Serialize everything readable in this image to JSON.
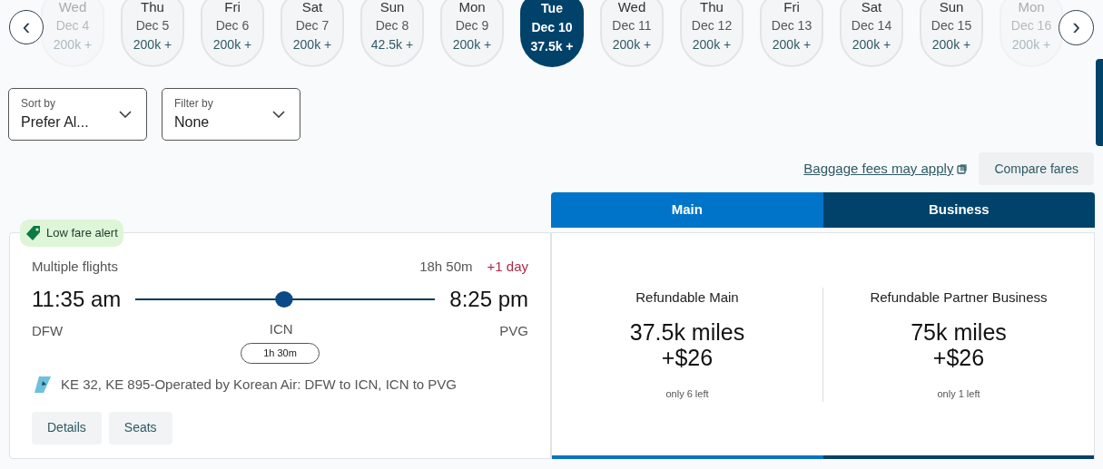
{
  "date_strip": {
    "prev_label": "‹",
    "next_label": "›",
    "dates": [
      {
        "weekday": "Wed",
        "date": "Dec 4",
        "price": "200k +",
        "selected": false,
        "faded": true
      },
      {
        "weekday": "Thu",
        "date": "Dec 5",
        "price": "200k +",
        "selected": false,
        "faded": false
      },
      {
        "weekday": "Fri",
        "date": "Dec 6",
        "price": "200k +",
        "selected": false,
        "faded": false
      },
      {
        "weekday": "Sat",
        "date": "Dec 7",
        "price": "200k +",
        "selected": false,
        "faded": false
      },
      {
        "weekday": "Sun",
        "date": "Dec 8",
        "price": "42.5k +",
        "selected": false,
        "faded": false
      },
      {
        "weekday": "Mon",
        "date": "Dec 9",
        "price": "200k +",
        "selected": false,
        "faded": false
      },
      {
        "weekday": "Tue",
        "date": "Dec 10",
        "price": "37.5k +",
        "selected": true,
        "faded": false
      },
      {
        "weekday": "Wed",
        "date": "Dec 11",
        "price": "200k +",
        "selected": false,
        "faded": false
      },
      {
        "weekday": "Thu",
        "date": "Dec 12",
        "price": "200k +",
        "selected": false,
        "faded": false
      },
      {
        "weekday": "Fri",
        "date": "Dec 13",
        "price": "200k +",
        "selected": false,
        "faded": false
      },
      {
        "weekday": "Sat",
        "date": "Dec 14",
        "price": "200k +",
        "selected": false,
        "faded": false
      },
      {
        "weekday": "Sun",
        "date": "Dec 15",
        "price": "200k +",
        "selected": false,
        "faded": false
      },
      {
        "weekday": "Mon",
        "date": "Dec 16",
        "price": "200k +",
        "selected": false,
        "faded": true
      }
    ]
  },
  "dropdowns": [
    {
      "label": "Sort by",
      "value": "Prefer Al..."
    },
    {
      "label": "Filter by",
      "value": "None"
    }
  ],
  "baggage_link": "Baggage fees may apply",
  "compare_button": "Compare fares",
  "cabin_tabs": [
    {
      "label": "Main",
      "color": "#0074c8"
    },
    {
      "label": "Business",
      "color": "#01426a"
    }
  ],
  "flight": {
    "badge": "Low fare alert",
    "type": "Multiple flights",
    "duration": "18h 50m",
    "day_offset": "+1 day",
    "depart_time": "11:35 am",
    "arrive_time": "8:25 pm",
    "origin": "DFW",
    "stop": "ICN",
    "destination": "PVG",
    "layover": "1h 30m",
    "operator": "KE 32, KE 895-Operated by Korean Air: DFW to ICN, ICN to PVG",
    "buttons": [
      "Details",
      "Seats"
    ]
  },
  "fares": [
    {
      "name": "Refundable Main",
      "miles": "37.5k miles",
      "fee": "+$26",
      "availability": "only 6 left"
    },
    {
      "name": "Refundable Partner Business",
      "miles": "75k miles",
      "fee": "+$26",
      "availability": "only 1 left"
    }
  ]
}
